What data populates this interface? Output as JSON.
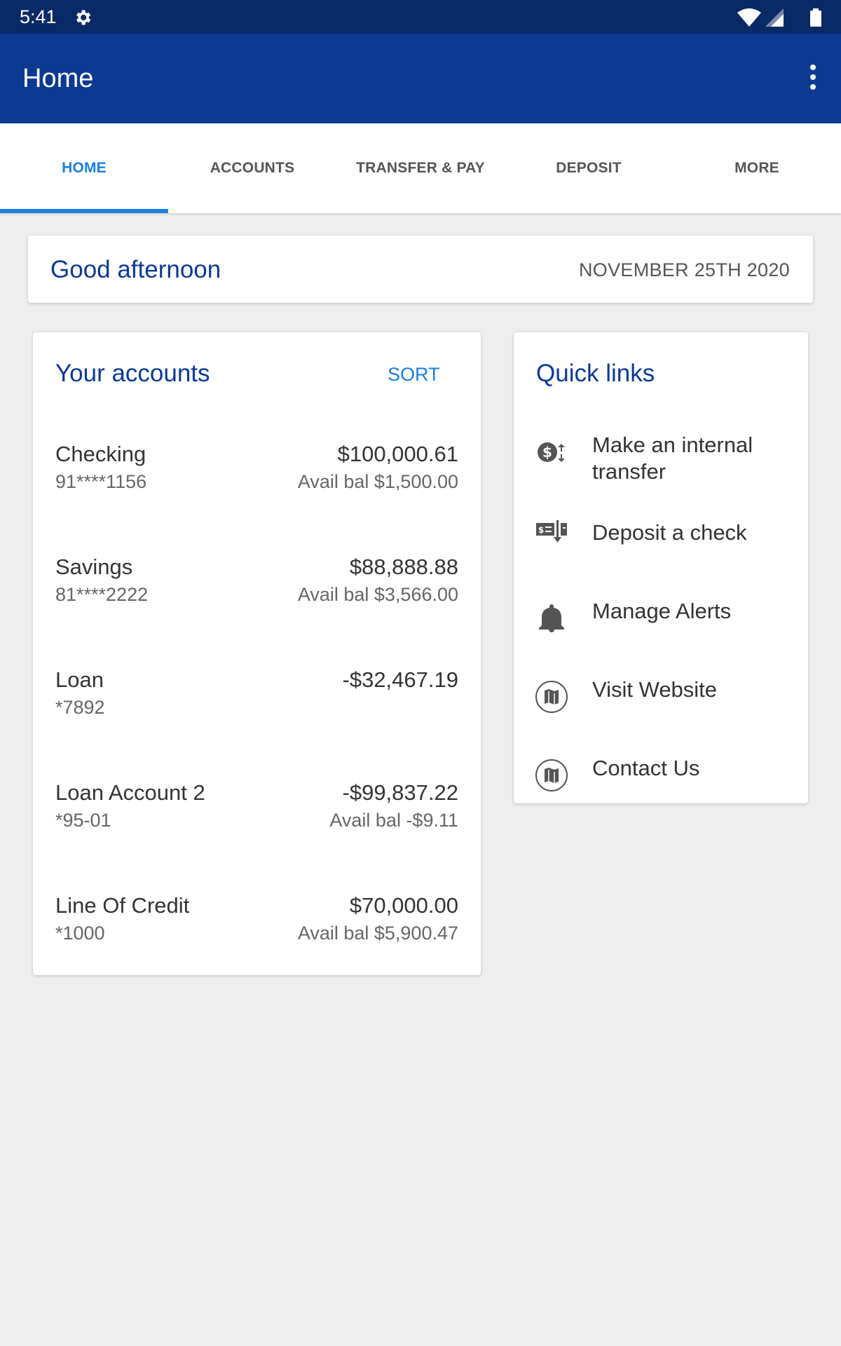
{
  "status_bar": {
    "time": "5:41",
    "icons": [
      "gear-icon",
      "wifi-icon",
      "signal-icon",
      "battery-icon"
    ]
  },
  "app_bar": {
    "title": "Home",
    "menu_icon": "more-vert-icon"
  },
  "tabs": [
    {
      "label": "HOME",
      "active": true
    },
    {
      "label": "ACCOUNTS",
      "active": false
    },
    {
      "label": "TRANSFER & PAY",
      "active": false
    },
    {
      "label": "DEPOSIT",
      "active": false
    },
    {
      "label": "MORE",
      "active": false
    }
  ],
  "greeting": {
    "text": "Good afternoon",
    "date": "NOVEMBER 25TH 2020"
  },
  "accounts": {
    "title": "Your accounts",
    "sort_label": "SORT",
    "items": [
      {
        "name": "Checking",
        "number": "91****1156",
        "balance": "$100,000.61",
        "avail": "Avail bal $1,500.00"
      },
      {
        "name": "Savings",
        "number": "81****2222",
        "balance": "$88,888.88",
        "avail": "Avail bal $3,566.00"
      },
      {
        "name": "Loan",
        "number": "*7892",
        "balance": "-$32,467.19",
        "avail": ""
      },
      {
        "name": "Loan Account 2",
        "number": "*95-01",
        "balance": "-$99,837.22",
        "avail": "Avail bal -$9.11"
      },
      {
        "name": "Line Of Credit",
        "number": "*1000",
        "balance": "$70,000.00",
        "avail": "Avail bal $5,900.47"
      }
    ]
  },
  "quick_links": {
    "title": "Quick links",
    "items": [
      {
        "label": "Make an internal transfer",
        "icon": "dollar-transfer-icon"
      },
      {
        "label": "Deposit a check",
        "icon": "check-deposit-icon"
      },
      {
        "label": "Manage Alerts",
        "icon": "bell-icon"
      },
      {
        "label": "Visit Website",
        "icon": "map-icon"
      },
      {
        "label": "Contact Us",
        "icon": "map-icon"
      }
    ]
  },
  "colors": {
    "status_bar": "#0a2a66",
    "app_bar": "#0d3a91",
    "accent": "#1a7fe0",
    "background": "#eeeeee"
  }
}
